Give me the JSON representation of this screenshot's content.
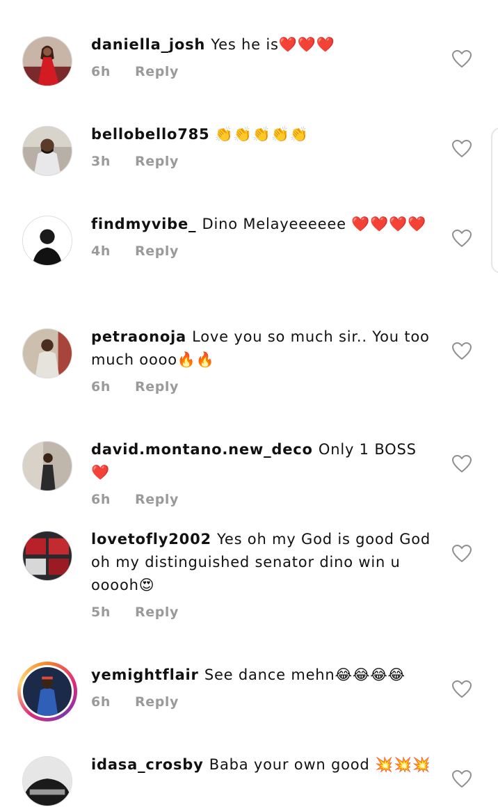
{
  "comments": [
    {
      "username": "daniella_josh",
      "text": "Yes he is❤️❤️❤️",
      "time": "6h",
      "reply_label": "Reply",
      "story_ring": false
    },
    {
      "username": "bellobello785",
      "text": " 👏👏👏👏👏",
      "time": "3h",
      "reply_label": "Reply",
      "story_ring": false
    },
    {
      "username": "findmyvibe_",
      "text": "Dino Melayeeeeee ❤️❤️❤️❤️",
      "time": "4h",
      "reply_label": "Reply",
      "story_ring": false
    },
    {
      "username": "petraonoja",
      "text": "Love you so much sir.. You too much oooo🔥🔥",
      "time": "6h",
      "reply_label": "Reply",
      "story_ring": false
    },
    {
      "username": "david.montano.new_deco",
      "text": "Only 1 BOSS ❤️",
      "time": "6h",
      "reply_label": "Reply",
      "story_ring": false
    },
    {
      "username": "lovetofly2002",
      "text": "Yes oh my God is good God oh my distinguished senator dino win u ooooh😍",
      "time": "5h",
      "reply_label": "Reply",
      "story_ring": false
    },
    {
      "username": "yemightflair",
      "text": "See dance mehn😂😂😂😂",
      "time": "6h",
      "reply_label": "Reply",
      "story_ring": true
    },
    {
      "username": "idasa_crosby",
      "text": "Baba your own good 💥💥💥",
      "time": "",
      "reply_label": "",
      "story_ring": false
    }
  ],
  "icons": {
    "like": "heart-outline-icon"
  },
  "colors": {
    "meta_gray": "#9a9a9a",
    "text": "#111111",
    "story_ring_start": "#f58529",
    "story_ring_end": "#dd2a7b"
  }
}
